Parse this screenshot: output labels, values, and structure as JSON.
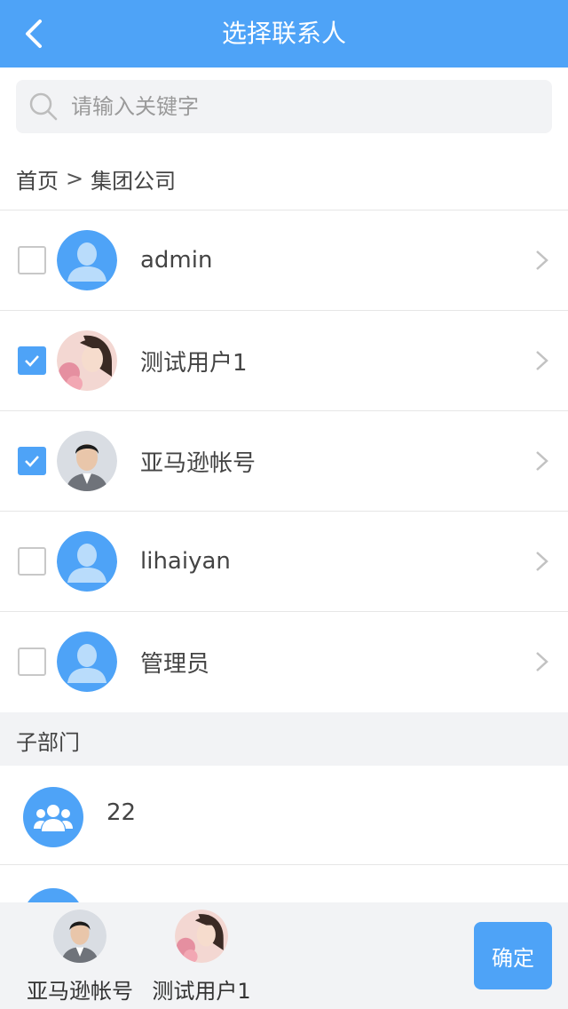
{
  "header": {
    "title": "选择联系人",
    "back_icon": "chevron-left-icon"
  },
  "search": {
    "placeholder": "请输入关键字",
    "value": ""
  },
  "breadcrumb": {
    "home": "首页",
    "separator": ">",
    "current": "集团公司"
  },
  "contacts": [
    {
      "name": "admin",
      "checked": false,
      "avatar": "default-avatar"
    },
    {
      "name": "测试用户1",
      "checked": true,
      "avatar": "photo-woman"
    },
    {
      "name": "亚马逊帐号",
      "checked": true,
      "avatar": "photo-man"
    },
    {
      "name": "lihaiyan",
      "checked": false,
      "avatar": "default-avatar"
    },
    {
      "name": "管理员",
      "checked": false,
      "avatar": "default-avatar"
    }
  ],
  "section": {
    "title": "子部门"
  },
  "departments": [
    {
      "name": "22",
      "icon": "group-icon"
    }
  ],
  "selected": [
    {
      "name": "亚马逊帐号",
      "avatar": "photo-man"
    },
    {
      "name": "测试用户1",
      "avatar": "photo-woman"
    }
  ],
  "confirm_label": "确定",
  "colors": {
    "primary": "#4ea3f7",
    "background_gray": "#f2f3f5",
    "divider": "#e6e6e6"
  }
}
